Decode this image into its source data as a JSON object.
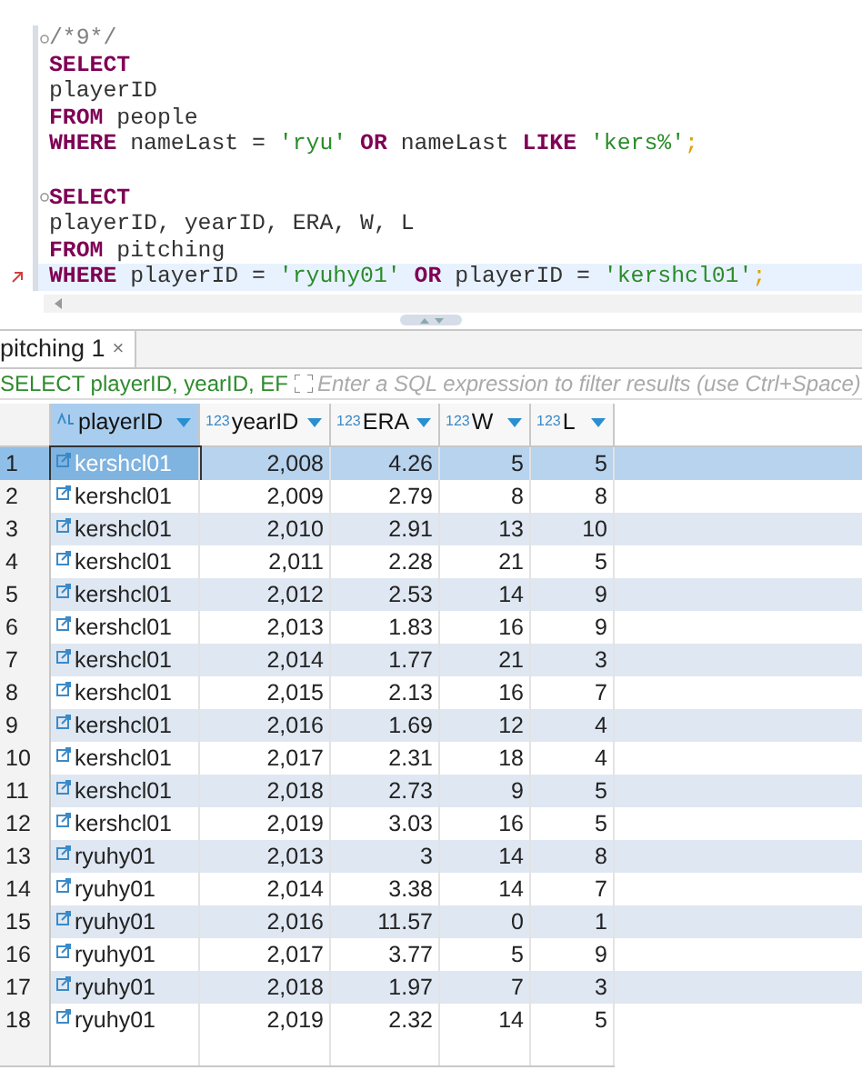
{
  "editor": {
    "lines": [
      {
        "kind": "code",
        "fold": true,
        "current": false,
        "error": false,
        "tokens": [
          {
            "kind": "comment",
            "text": "/*9*/"
          }
        ]
      },
      {
        "kind": "code",
        "fold": false,
        "current": false,
        "error": false,
        "tokens": [
          {
            "kind": "keyword",
            "text": "SELECT"
          }
        ]
      },
      {
        "kind": "code",
        "fold": false,
        "current": false,
        "error": false,
        "tokens": [
          {
            "kind": "plain",
            "text": "playerID"
          }
        ]
      },
      {
        "kind": "code",
        "fold": false,
        "current": false,
        "error": false,
        "tokens": [
          {
            "kind": "keyword",
            "text": "FROM"
          },
          {
            "kind": "plain",
            "text": " people"
          }
        ]
      },
      {
        "kind": "code",
        "fold": false,
        "current": false,
        "error": false,
        "tokens": [
          {
            "kind": "keyword",
            "text": "WHERE"
          },
          {
            "kind": "plain",
            "text": " nameLast = "
          },
          {
            "kind": "string",
            "text": "'ryu'"
          },
          {
            "kind": "keyword",
            "text": " OR"
          },
          {
            "kind": "plain",
            "text": " nameLast "
          },
          {
            "kind": "keyword",
            "text": "LIKE"
          },
          {
            "kind": "string",
            "text": " 'kers%'"
          },
          {
            "kind": "punct",
            "text": ";"
          }
        ]
      },
      {
        "kind": "blank"
      },
      {
        "kind": "code",
        "fold": true,
        "current": false,
        "error": false,
        "tokens": [
          {
            "kind": "keyword",
            "text": "SELECT"
          }
        ]
      },
      {
        "kind": "code",
        "fold": false,
        "current": false,
        "error": false,
        "tokens": [
          {
            "kind": "plain",
            "text": "playerID, yearID, ERA, W, L"
          }
        ]
      },
      {
        "kind": "code",
        "fold": false,
        "current": false,
        "error": false,
        "tokens": [
          {
            "kind": "keyword",
            "text": "FROM"
          },
          {
            "kind": "plain",
            "text": " pitching"
          }
        ]
      },
      {
        "kind": "code",
        "fold": false,
        "current": true,
        "error": true,
        "tokens": [
          {
            "kind": "keyword",
            "text": "WHERE"
          },
          {
            "kind": "plain",
            "text": " playerID = "
          },
          {
            "kind": "string",
            "text": "'ryuhy01'"
          },
          {
            "kind": "keyword",
            "text": " OR"
          },
          {
            "kind": "plain",
            "text": " playerID = "
          },
          {
            "kind": "string",
            "text": "'kershcl01'"
          },
          {
            "kind": "punct",
            "text": ";"
          }
        ]
      }
    ]
  },
  "results_tab": {
    "label": "pitching 1",
    "close": "×"
  },
  "filter": {
    "query": "SELECT playerID, yearID, EF",
    "placeholder": "Enter a SQL expression to filter results (use Ctrl+Space)"
  },
  "table": {
    "columns": [
      {
        "label": "playerID",
        "kind": "text",
        "selected": true
      },
      {
        "label": "yearID",
        "kind": "number",
        "type_label": "123",
        "selected": false
      },
      {
        "label": "ERA",
        "kind": "number",
        "type_label": "123",
        "selected": false
      },
      {
        "label": "W",
        "kind": "number",
        "type_label": "123",
        "selected": false
      },
      {
        "label": "L",
        "kind": "number",
        "type_label": "123",
        "selected": false
      }
    ],
    "rows": [
      {
        "num": "1",
        "selected": true,
        "cells": [
          "kershcl01",
          "2,008",
          "4.26",
          "5",
          "5"
        ]
      },
      {
        "num": "2",
        "selected": false,
        "cells": [
          "kershcl01",
          "2,009",
          "2.79",
          "8",
          "8"
        ]
      },
      {
        "num": "3",
        "selected": false,
        "cells": [
          "kershcl01",
          "2,010",
          "2.91",
          "13",
          "10"
        ]
      },
      {
        "num": "4",
        "selected": false,
        "cells": [
          "kershcl01",
          "2,011",
          "2.28",
          "21",
          "5"
        ]
      },
      {
        "num": "5",
        "selected": false,
        "cells": [
          "kershcl01",
          "2,012",
          "2.53",
          "14",
          "9"
        ]
      },
      {
        "num": "6",
        "selected": false,
        "cells": [
          "kershcl01",
          "2,013",
          "1.83",
          "16",
          "9"
        ]
      },
      {
        "num": "7",
        "selected": false,
        "cells": [
          "kershcl01",
          "2,014",
          "1.77",
          "21",
          "3"
        ]
      },
      {
        "num": "8",
        "selected": false,
        "cells": [
          "kershcl01",
          "2,015",
          "2.13",
          "16",
          "7"
        ]
      },
      {
        "num": "9",
        "selected": false,
        "cells": [
          "kershcl01",
          "2,016",
          "1.69",
          "12",
          "4"
        ]
      },
      {
        "num": "10",
        "selected": false,
        "cells": [
          "kershcl01",
          "2,017",
          "2.31",
          "18",
          "4"
        ]
      },
      {
        "num": "11",
        "selected": false,
        "cells": [
          "kershcl01",
          "2,018",
          "2.73",
          "9",
          "5"
        ]
      },
      {
        "num": "12",
        "selected": false,
        "cells": [
          "kershcl01",
          "2,019",
          "3.03",
          "16",
          "5"
        ]
      },
      {
        "num": "13",
        "selected": false,
        "cells": [
          "ryuhy01",
          "2,013",
          "3",
          "14",
          "8"
        ]
      },
      {
        "num": "14",
        "selected": false,
        "cells": [
          "ryuhy01",
          "2,014",
          "3.38",
          "14",
          "7"
        ]
      },
      {
        "num": "15",
        "selected": false,
        "cells": [
          "ryuhy01",
          "2,016",
          "11.57",
          "0",
          "1"
        ]
      },
      {
        "num": "16",
        "selected": false,
        "cells": [
          "ryuhy01",
          "2,017",
          "3.77",
          "5",
          "9"
        ]
      },
      {
        "num": "17",
        "selected": false,
        "cells": [
          "ryuhy01",
          "2,018",
          "1.97",
          "7",
          "3"
        ]
      },
      {
        "num": "18",
        "selected": false,
        "cells": [
          "ryuhy01",
          "2,019",
          "2.32",
          "14",
          "5"
        ]
      }
    ]
  }
}
